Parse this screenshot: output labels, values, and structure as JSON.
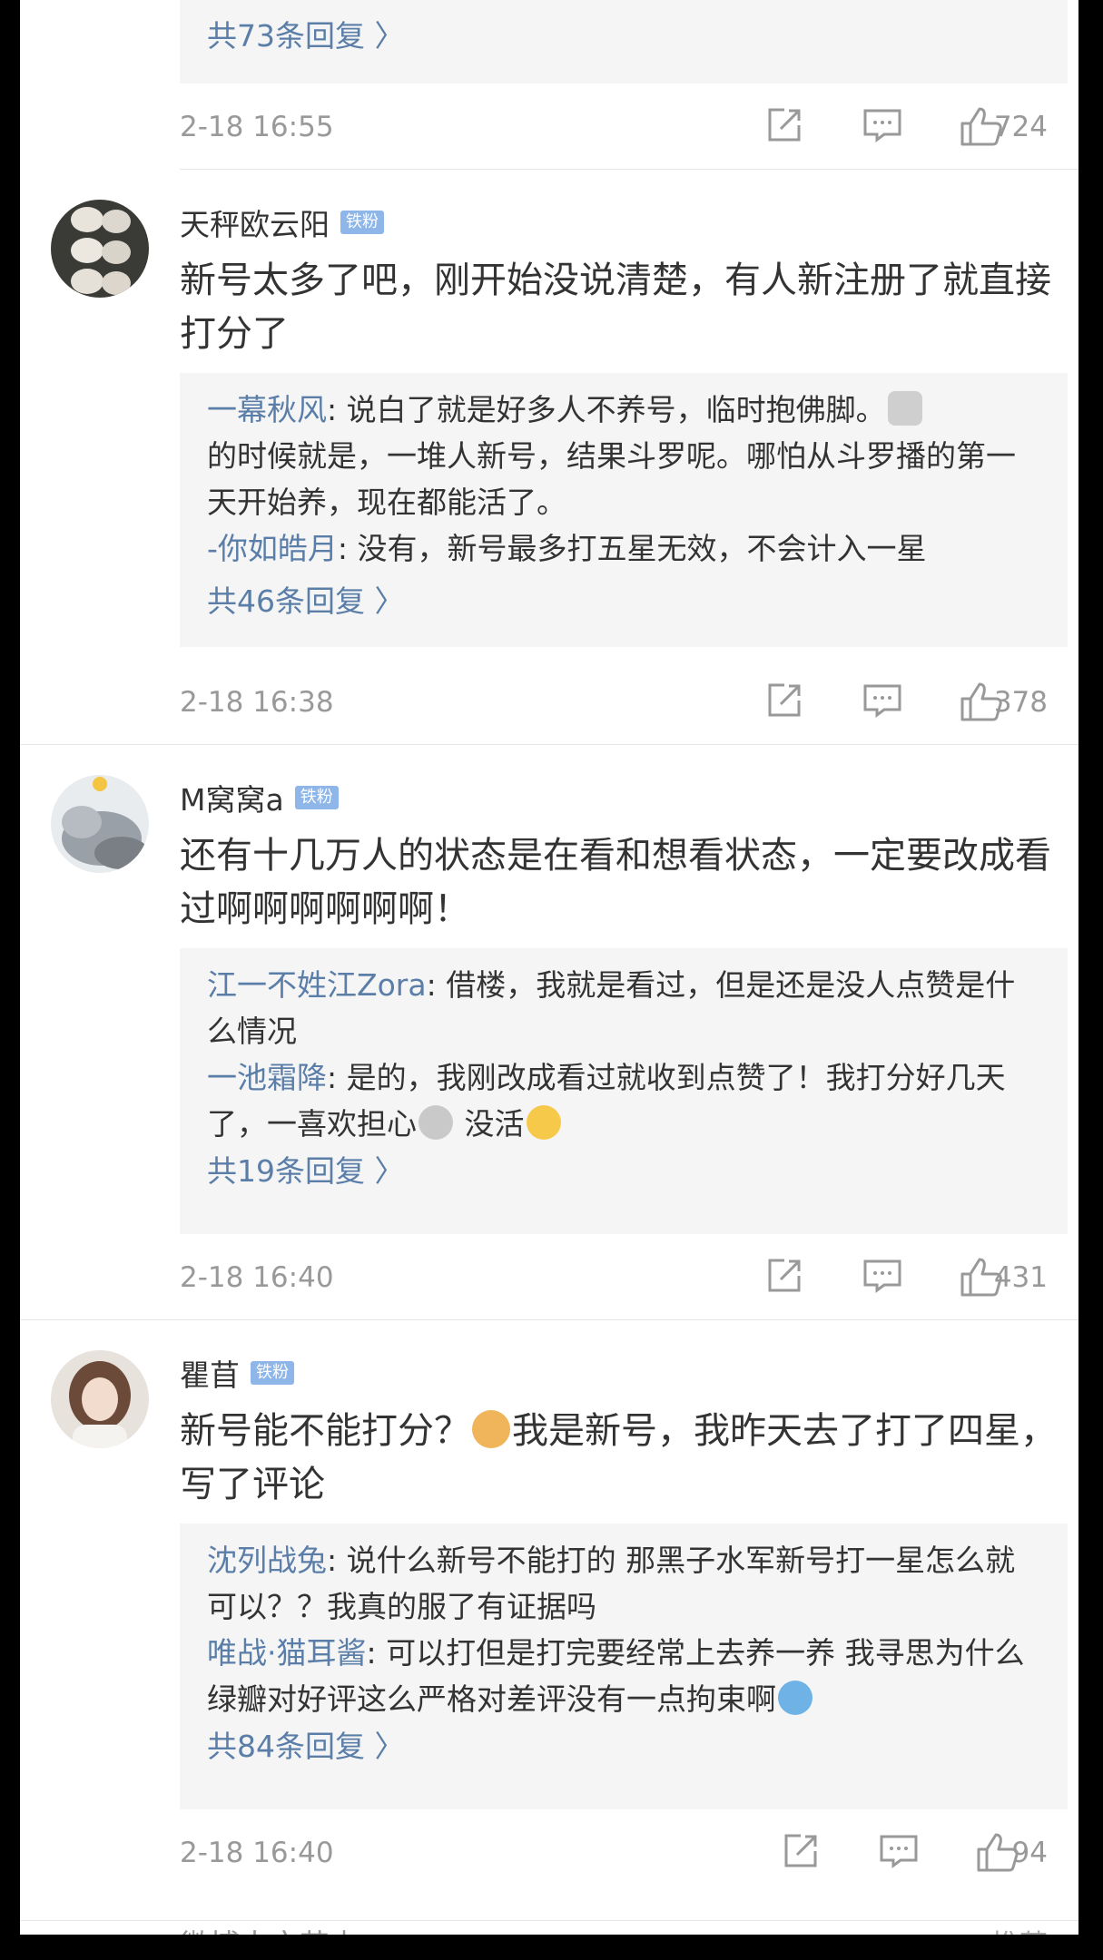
{
  "top": {
    "more": "共73条回复 〉",
    "time": "2-18 16:55",
    "likes": "724"
  },
  "comments": [
    {
      "name": "天秤欧云阳",
      "badge": "铁粉",
      "text": "新号太多了吧，刚开始没说清楚，有人新注册了就直接打分了",
      "replies": [
        {
          "name": "一幕秋风",
          "text": ": 说白了就是好多人不养号，临时抱佛脚。",
          "text2": "的时候就是，一堆人新号，结果斗罗呢。哪怕从斗罗播的第一天开始养，现在都能活了。"
        },
        {
          "name": "-你如皓月",
          "text": ": 没有，新号最多打五星无效，不会计入一星"
        }
      ],
      "more": "共46条回复 〉",
      "time": "2-18 16:38",
      "likes": "378"
    },
    {
      "name": "M窝窝a",
      "badge": "铁粉",
      "text": "还有十几万人的状态是在看和想看状态，一定要改成看过啊啊啊啊啊啊！",
      "replies": [
        {
          "name": "江一不姓江Zora",
          "text": ": 借楼，我就是看过，但是还是没人点赞是什么情况"
        },
        {
          "name": "一池霜降",
          "text": ": 是的，我刚改成看过就收到点赞了！我打分好几天了，一喜欢担心",
          "text2": " 没活"
        }
      ],
      "more": "共19条回复 〉",
      "time": "2-18 16:40",
      "likes": "431"
    },
    {
      "name": "瞿苜",
      "badge": "铁粉",
      "text": "新号能不能打分？",
      "text2": "我是新号，我昨天去了打了四星，写了评论",
      "replies": [
        {
          "name": "沈列战兔",
          "text": ": 说什么新号不能打的 那黑子水军新号打一星怎么就可以？？我真的服了有证据吗"
        },
        {
          "name": "唯战·猫耳酱",
          "text": ": 可以打但是打完要经常上去养一养 我寻思为什么绿瓣对好评这么严格对差评没有一点拘束啊"
        }
      ],
      "more": "共84条回复 〉",
      "time": "2-18 16:40",
      "likes": "94"
    }
  ],
  "cut": {
    "name": "微博大文艺少",
    "right": "推荐"
  },
  "colors": {
    "link": "#5a7ea8",
    "badge": "#8eb6e8",
    "gray": "#999999",
    "panel": "#f5f5f5"
  }
}
